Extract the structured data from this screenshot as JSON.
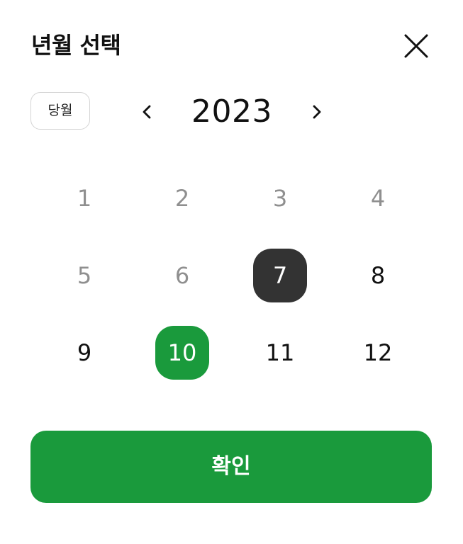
{
  "header": {
    "title": "년월 선택",
    "close_icon": "close-icon"
  },
  "controls": {
    "current_month_label": "당월",
    "year": "2023",
    "prev_icon": "chevron-left-icon",
    "next_icon": "chevron-right-icon"
  },
  "months": [
    {
      "label": "1",
      "state": "disabled"
    },
    {
      "label": "2",
      "state": "disabled"
    },
    {
      "label": "3",
      "state": "disabled"
    },
    {
      "label": "4",
      "state": "disabled"
    },
    {
      "label": "5",
      "state": "disabled"
    },
    {
      "label": "6",
      "state": "disabled"
    },
    {
      "label": "7",
      "state": "selected"
    },
    {
      "label": "8",
      "state": "enabled"
    },
    {
      "label": "9",
      "state": "enabled"
    },
    {
      "label": "10",
      "state": "current"
    },
    {
      "label": "11",
      "state": "enabled"
    },
    {
      "label": "12",
      "state": "enabled"
    }
  ],
  "footer": {
    "confirm_label": "확인"
  },
  "colors": {
    "accent_green": "#1a9a3c",
    "selected_dark": "#333333",
    "disabled_text": "#8f8f8f"
  }
}
